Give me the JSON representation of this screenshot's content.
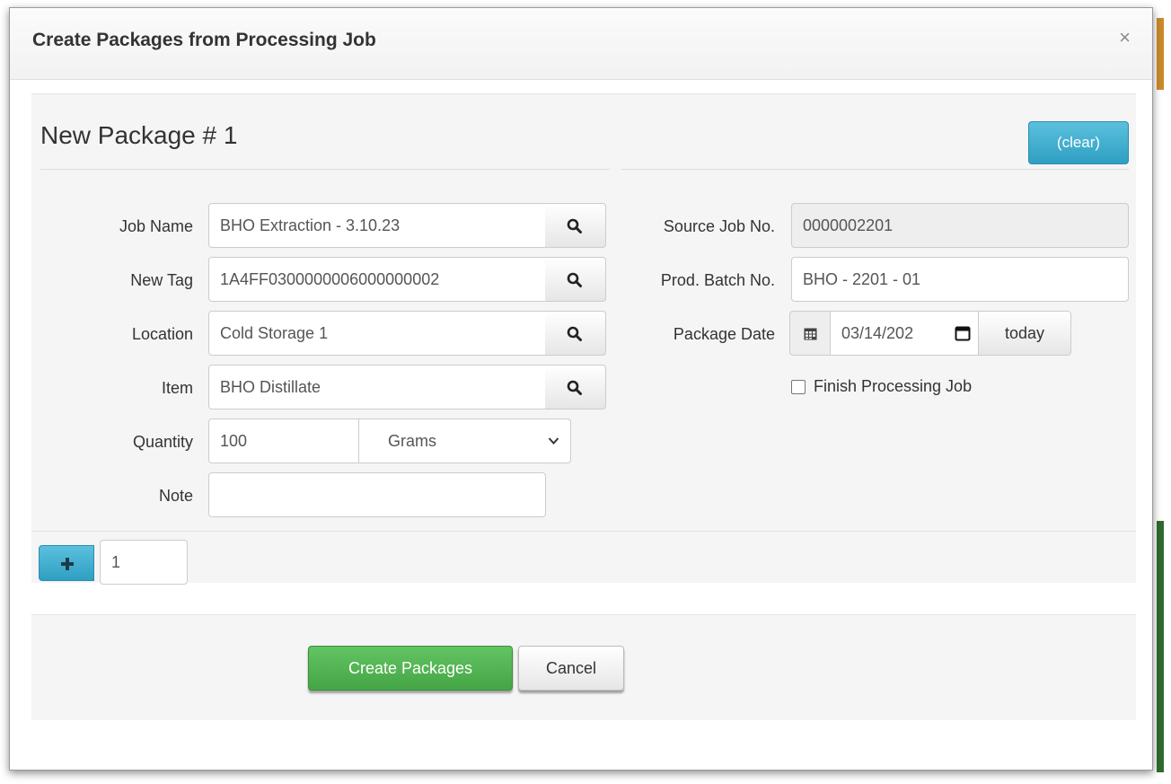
{
  "dialog": {
    "title": "Create Packages from Processing Job",
    "close_glyph": "×"
  },
  "package": {
    "heading": "New Package # 1",
    "clear_label": "(clear)"
  },
  "form_left": {
    "job_name_label": "Job Name",
    "job_name_value": "BHO Extraction - 3.10.23",
    "new_tag_label": "New Tag",
    "new_tag_value": "1A4FF0300000006000000002",
    "location_label": "Location",
    "location_value": "Cold Storage 1",
    "item_label": "Item",
    "item_value": "BHO Distillate",
    "quantity_label": "Quantity",
    "quantity_value": "100",
    "unit_selected": "Grams",
    "note_label": "Note",
    "note_value": ""
  },
  "form_right": {
    "source_job_label": "Source Job No.",
    "source_job_value": "0000002201",
    "prod_batch_label": "Prod. Batch No.",
    "prod_batch_value": "BHO - 2201 - 01",
    "package_date_label": "Package Date",
    "package_date_value": "03/14/202",
    "today_label": "today",
    "finish_job_label": "Finish Processing Job",
    "finish_job_checked": false
  },
  "add_packages": {
    "count_value": "1"
  },
  "footer": {
    "create_label": "Create Packages",
    "cancel_label": "Cancel"
  },
  "colors": {
    "primary_info": "#5bc0de",
    "success": "#45a545"
  }
}
